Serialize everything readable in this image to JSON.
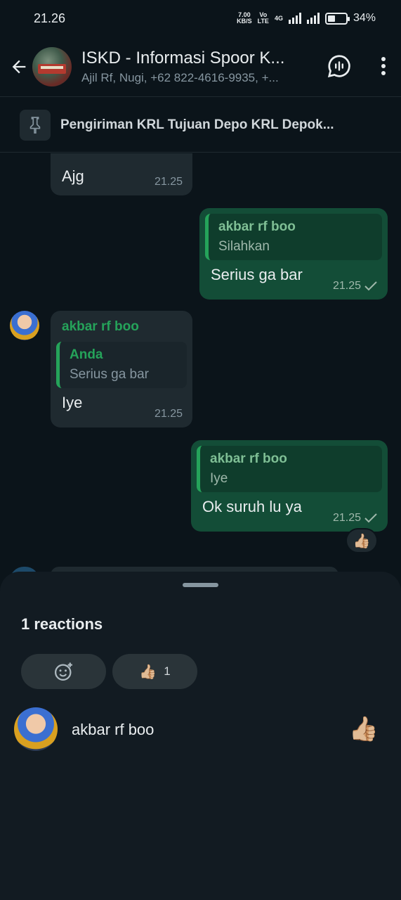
{
  "status_bar": {
    "time": "21.26",
    "net_speed": "7.00",
    "net_unit": "KB/S",
    "volte_top": "Vo",
    "volte_bottom": "LTE",
    "network": "4G",
    "battery": "34%"
  },
  "header": {
    "title": "ISKD - Informasi Spoor K...",
    "subtitle": "Ajil Rf, Nugi, +62 822-4616-9935, +..."
  },
  "pinned": {
    "text": "Pengiriman KRL Tujuan Depo KRL Depok..."
  },
  "messages": [
    {
      "text": "Ajg",
      "time": "21.25"
    },
    {
      "quote_name": "akbar rf boo",
      "quote_text": "Silahkan",
      "text": "Serius ga bar",
      "time": "21.25"
    },
    {
      "sender": "akbar rf boo",
      "quote_name": "Anda",
      "quote_text": "Serius ga bar",
      "text": "Iye",
      "time": "21.25"
    },
    {
      "quote_name": "akbar rf boo",
      "quote_text": "Iye",
      "text": "Ok suruh lu ya",
      "time": "21.25",
      "reaction": "👍🏼"
    }
  ],
  "sheet": {
    "title": "1 reactions",
    "chip_count": "1",
    "chip_emoji": "👍🏼",
    "user": {
      "name": "akbar rf boo",
      "reaction": "👍🏼"
    }
  }
}
